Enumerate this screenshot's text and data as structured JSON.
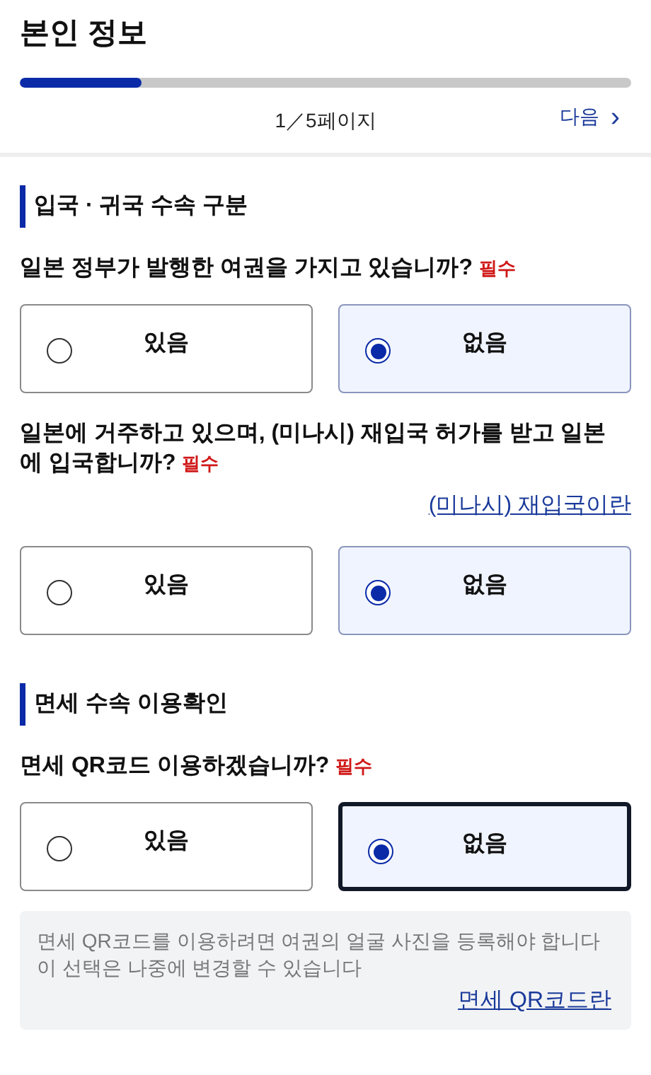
{
  "title": "본인 정보",
  "progress": {
    "level": 0.2,
    "label": "1／5페이지"
  },
  "next_button": {
    "label": "다음",
    "icon": "›"
  },
  "sections": [
    {
      "heading": "입국 · 귀국 수속 구분",
      "questions": [
        {
          "text": "일본 정부가 발행한 여권을 가지고 있습니까?",
          "required": "필수",
          "options": [
            {
              "label": "있음",
              "selected": false,
              "focused": false
            },
            {
              "label": "없음",
              "selected": true,
              "focused": false
            }
          ]
        },
        {
          "text": "일본에 거주하고 있으며, (미나시) 재입국 허가를 받고 일본에 입국합니까?",
          "required": "필수",
          "link": "(미나시) 재입국이란",
          "options": [
            {
              "label": "있음",
              "selected": false,
              "focused": false
            },
            {
              "label": "없음",
              "selected": true,
              "focused": false
            }
          ]
        }
      ]
    },
    {
      "heading": "면세 수속 이용확인",
      "questions": [
        {
          "text": "면세 QR코드 이용하겠습니까?",
          "required": "필수",
          "options": [
            {
              "label": "있음",
              "selected": false,
              "focused": false
            },
            {
              "label": "없음",
              "selected": true,
              "focused": true
            }
          ],
          "note": {
            "lines": [
              "면세 QR코드를 이용하려면 여권의 얼굴 사진을 등록해야 합니다",
              "이 선택은 나중에 변경할 수 있습니다"
            ],
            "link": "면세 QR코드란"
          }
        }
      ]
    }
  ]
}
